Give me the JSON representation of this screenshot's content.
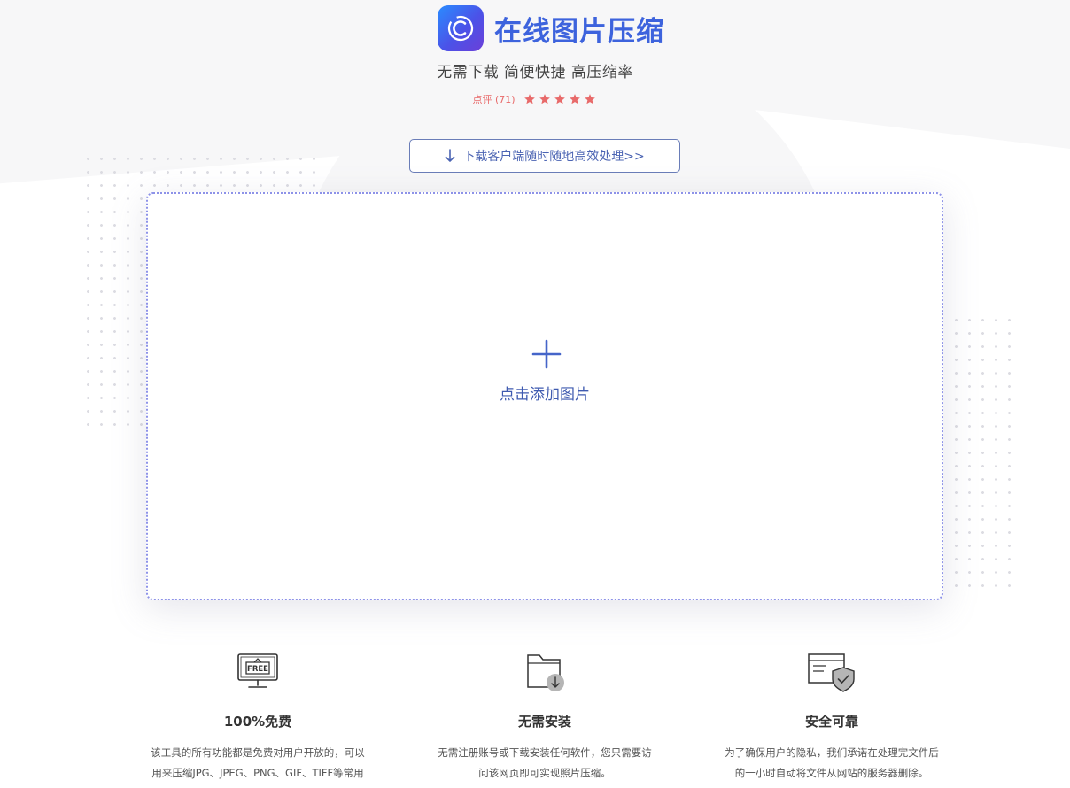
{
  "header": {
    "title": "在线图片压缩",
    "subtitle": "无需下载 简便快捷 高压缩率",
    "rating_label": "点评 (71)",
    "star_count": 5,
    "accent_color": "#3d63dd",
    "star_color": "#e86a6a"
  },
  "download_button": {
    "label": "下载客户端随时随地高效处理>>",
    "icon": "download-arrow-icon"
  },
  "upload": {
    "label": "点击添加图片",
    "icon": "plus-icon",
    "border_color": "#8d92e8"
  },
  "features": [
    {
      "icon": "free-monitor-icon",
      "title": "100%免费",
      "description": "该工具的所有功能都是免费对用户开放的，可以用来压缩JPG、JPEG、PNG、GIF、TIFF等常用格式图片。"
    },
    {
      "icon": "folder-download-icon",
      "title": "无需安装",
      "description": "无需注册账号或下载安装任何软件，您只需要访问该网页即可实现照片压缩。"
    },
    {
      "icon": "secure-shield-icon",
      "title": "安全可靠",
      "description": "为了确保用户的隐私，我们承诺在处理完文件后的一小时自动将文件从网站的服务器删除。"
    }
  ]
}
